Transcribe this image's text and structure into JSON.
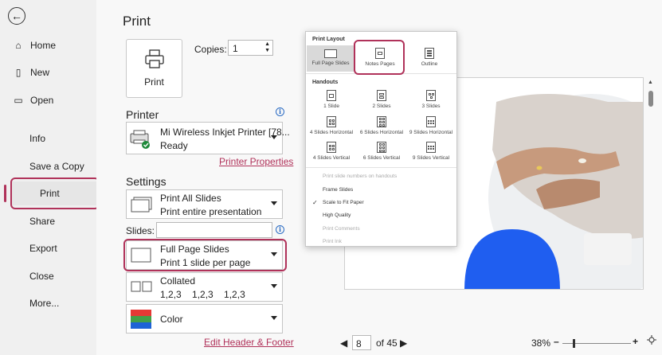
{
  "sidebar": {
    "items": [
      {
        "label": "Home",
        "icon": "home-icon"
      },
      {
        "label": "New",
        "icon": "new-document-icon"
      },
      {
        "label": "Open",
        "icon": "folder-open-icon"
      },
      {
        "label": "Info"
      },
      {
        "label": "Save a Copy"
      },
      {
        "label": "Print"
      },
      {
        "label": "Share"
      },
      {
        "label": "Export"
      },
      {
        "label": "Close"
      },
      {
        "label": "More..."
      }
    ]
  },
  "print": {
    "title": "Print",
    "button_label": "Print",
    "copies_label": "Copies:",
    "copies_value": "1"
  },
  "printer": {
    "heading": "Printer",
    "name": "Mi Wireless Inkjet Printer [78...",
    "status": "Ready",
    "properties_link": "Printer Properties"
  },
  "settings": {
    "heading": "Settings",
    "slides_range": {
      "line1": "Print All Slides",
      "line2": "Print entire presentation"
    },
    "slides_label": "Slides:",
    "slides_value": "",
    "layout": {
      "line1": "Full Page Slides",
      "line2": "Print 1 slide per page"
    },
    "collation": {
      "line1": "Collated",
      "line2": "1,2,3    1,2,3    1,2,3"
    },
    "color": {
      "line1": "Color"
    },
    "header_footer_link": "Edit Header & Footer"
  },
  "layout_menu": {
    "print_layout_heading": "Print Layout",
    "print_layout_items": [
      "Full Page Slides",
      "Notes Pages",
      "Outline"
    ],
    "handouts_heading": "Handouts",
    "handout_items": [
      "1 Slide",
      "2 Slides",
      "3 Slides",
      "4 Slides Horizontal",
      "6 Slides Horizontal",
      "9 Slides Horizontal",
      "4 Slides Vertical",
      "6 Slides Vertical",
      "9 Slides Vertical"
    ],
    "options": [
      {
        "label": "Print slide numbers on handouts",
        "enabled": false,
        "checked": false
      },
      {
        "label": "Frame Slides",
        "enabled": true,
        "checked": false
      },
      {
        "label": "Scale to Fit Paper",
        "enabled": true,
        "checked": true
      },
      {
        "label": "High Quality",
        "enabled": true,
        "checked": false
      },
      {
        "label": "Print Comments",
        "enabled": false,
        "checked": false
      },
      {
        "label": "Print Ink",
        "enabled": false,
        "checked": false
      }
    ]
  },
  "pager": {
    "current_page": "8",
    "of_total": "of 45",
    "zoom": "38%"
  },
  "colors": {
    "accent": "#b0325a",
    "link": "#b0325a",
    "info": "#2b6cc4",
    "preview_blue": "#1f5ef0"
  }
}
